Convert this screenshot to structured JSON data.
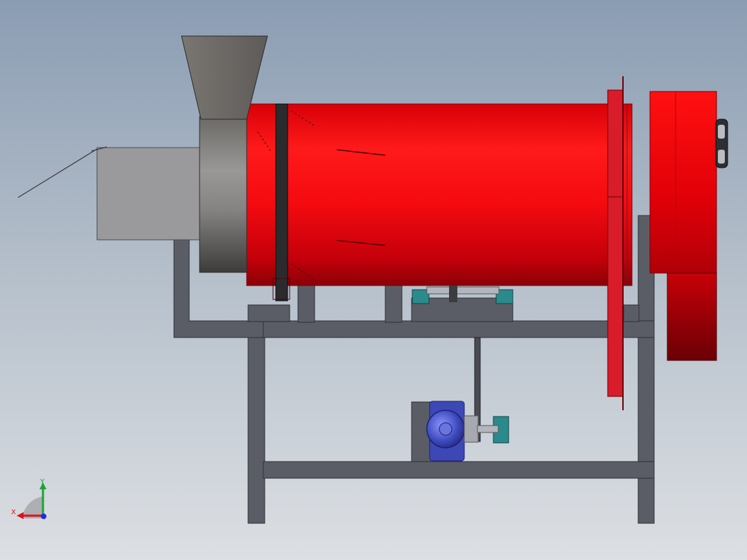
{
  "triad": {
    "x_label": "X",
    "y_label": "Y",
    "x_color": "#e0101a",
    "y_color": "#19a531",
    "z_color": "#1a2fe0"
  },
  "colors": {
    "background_top": "#8b9db3",
    "background_bottom": "#dcdfe3",
    "drum": "#e8050b",
    "frame": "#5a5c66",
    "motor": "#4a57c8",
    "bearing": "#2a8a8c",
    "hopper": "#6e6b67"
  }
}
